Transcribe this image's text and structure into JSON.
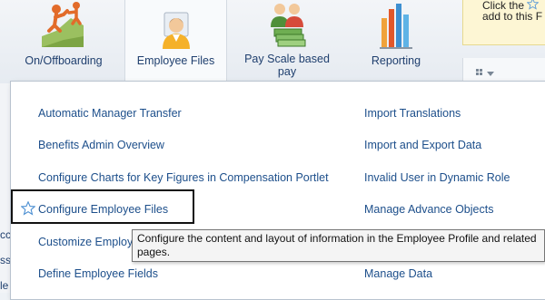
{
  "nav": {
    "tiles": [
      {
        "label": "On/Offboarding",
        "icon": "onboarding-climb-icon"
      },
      {
        "label": "Employee Files",
        "icon": "employee-person-icon"
      },
      {
        "label": "Pay Scale based pay",
        "icon": "pay-scale-people-money-icon"
      },
      {
        "label": "Reporting",
        "icon": "bar-chart-icon"
      }
    ]
  },
  "right_panel": {
    "line1": "Click the",
    "line2": "add to this F"
  },
  "menu": {
    "left_items": [
      "Automatic Manager Transfer",
      "Benefits Admin Overview",
      "Configure Charts for Key Figures in Compensation Portlet",
      "Configure Employee Files",
      "Customize Employ",
      "Define Employee Fields"
    ],
    "right_items": [
      "Import Translations",
      "Import and Export Data",
      "Invalid User in Dynamic Role",
      "Manage Advance Objects",
      "Manage Data"
    ]
  },
  "tooltip": {
    "text": "Configure the content and layout of information in the Employee Profile and related pages."
  },
  "colors": {
    "link": "#1d4f8b",
    "tile_text": "#1f3f6e",
    "panel_yellow": "#fdf6d4"
  }
}
